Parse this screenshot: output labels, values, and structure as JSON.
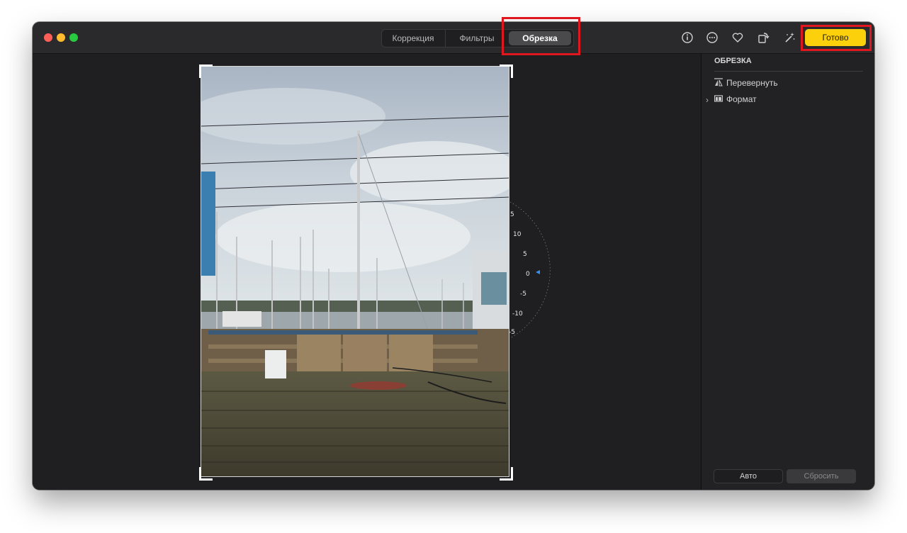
{
  "window": {
    "traffic_lights": [
      "close",
      "minimize",
      "zoom"
    ]
  },
  "toolbar": {
    "tabs": [
      {
        "label": "Коррекция",
        "active": false
      },
      {
        "label": "Фильтры",
        "active": false
      },
      {
        "label": "Обрезка",
        "active": true
      }
    ],
    "icons": [
      "info-icon",
      "more-icon",
      "favorite-heart-icon",
      "rotate-icon",
      "auto-enhance-icon"
    ],
    "done_label": "Готово",
    "done_color": "#fcd00b",
    "highlight_color": "#e0171f"
  },
  "straighten_dial": {
    "labels": [
      "5",
      "10",
      "5",
      "0",
      "-5",
      "-10",
      "-5"
    ],
    "current_value": "0"
  },
  "sidebar": {
    "title": "ОБРЕЗКА",
    "items": [
      {
        "label": "Перевернуть",
        "icon": "flip-icon"
      },
      {
        "label": "Формат",
        "icon": "aspect-ratio-icon",
        "expandable": true
      }
    ],
    "auto_label": "Авто",
    "reset_label": "Сбросить"
  }
}
